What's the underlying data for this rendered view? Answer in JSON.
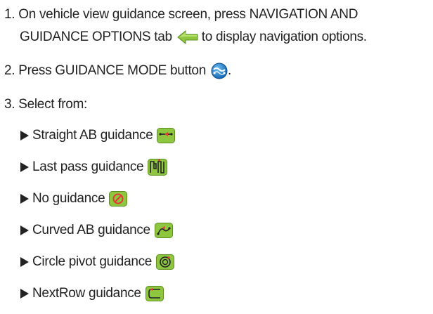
{
  "steps": [
    {
      "number": "1.",
      "lines": [
        "On vehicle view guidance screen, press NAVIGATION AND",
        "GUIDANCE OPTIONS tab",
        "to display navigation options."
      ],
      "icon": "green-left-arrow-icon"
    },
    {
      "number": "2.",
      "text": "Press GUIDANCE MODE button",
      "suffix": ".",
      "icon": "blue-guidance-mode-icon"
    },
    {
      "number": "3.",
      "text": "Select from:"
    }
  ],
  "options": [
    {
      "label": "Straight AB guidance",
      "icon": "straight-ab-icon"
    },
    {
      "label": "Last pass guidance",
      "icon": "last-pass-icon"
    },
    {
      "label": "No guidance",
      "icon": "no-guidance-icon"
    },
    {
      "label": "Curved AB guidance",
      "icon": "curved-ab-icon"
    },
    {
      "label": "Circle pivot guidance",
      "icon": "circle-pivot-icon"
    },
    {
      "label": "NextRow guidance",
      "icon": "nextrow-icon"
    }
  ],
  "colors": {
    "text": "#222222",
    "icon_green": "#8ec63f",
    "icon_green_dark": "#5a8f1f",
    "icon_blue": "#1e88d2",
    "icon_red": "#e53935"
  }
}
